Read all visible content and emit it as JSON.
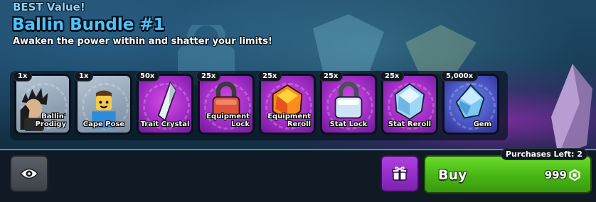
{
  "offer": {
    "badge": "BEST Value!",
    "title": "Ballin Bundle #1",
    "subtitle": "Awaken the power within and shatter your limits!"
  },
  "items": [
    {
      "qty": "1x",
      "name": "Ballin' Prodigy",
      "icon": "character-portrait-icon",
      "style": "grey"
    },
    {
      "qty": "1x",
      "name": "Cape Pose",
      "icon": "avatar-pose-icon",
      "style": "grey"
    },
    {
      "qty": "50x",
      "name": "Trait Crystal",
      "icon": "crystal-shard-icon",
      "style": "purple"
    },
    {
      "qty": "25x",
      "name": "Equipment Lock",
      "icon": "red-padlock-icon",
      "style": "purple"
    },
    {
      "qty": "25x",
      "name": "Equipment Reroll",
      "icon": "orange-gem-icon",
      "style": "purple"
    },
    {
      "qty": "25x",
      "name": "Stat Lock",
      "icon": "silver-padlock-icon",
      "style": "purple"
    },
    {
      "qty": "25x",
      "name": "Stat Reroll",
      "icon": "blue-gem-icon",
      "style": "purple"
    },
    {
      "qty": "5,000x",
      "name": "Gem",
      "icon": "gem-icon",
      "style": "blue"
    }
  ],
  "actions": {
    "view_icon": "eye-icon",
    "gift_icon": "gift-icon",
    "buy_label": "Buy",
    "price": "999",
    "currency_icon": "robux-icon",
    "purchases_left": "Purchases Left: 2"
  },
  "colors": {
    "title": "#4fc2ff",
    "buy": "#47b514",
    "gift": "#9a30cc",
    "item_purple": "#a12dc6",
    "item_blue": "#4a55c4"
  }
}
